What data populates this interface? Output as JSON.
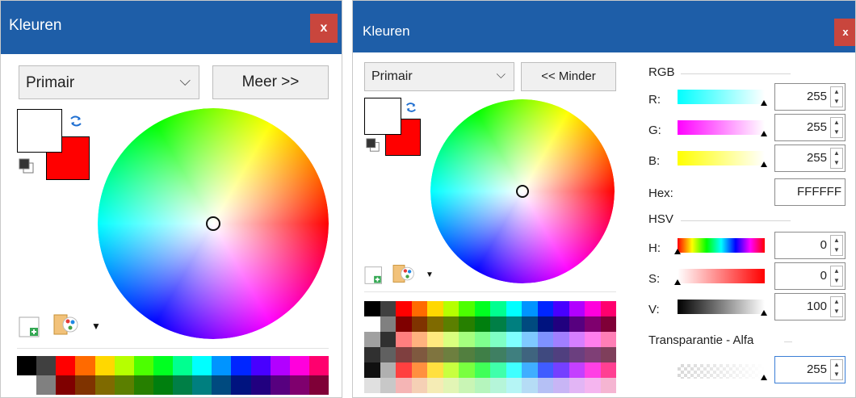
{
  "left": {
    "title": "Kleuren",
    "close_label": "x",
    "mode_select": "Primair",
    "more_button": "Meer >>",
    "colors": {
      "primary": "#ffffff",
      "secondary": "#ff0000"
    }
  },
  "right": {
    "title": "Kleuren",
    "close_label": "x",
    "mode_select": "Primair",
    "less_button": "<< Minder",
    "rgb": {
      "section": "RGB",
      "r_label": "R:",
      "r_value": "255",
      "g_label": "G:",
      "g_value": "255",
      "b_label": "B:",
      "b_value": "255",
      "hex_label": "Hex:",
      "hex_value": "FFFFFF"
    },
    "hsv": {
      "section": "HSV",
      "h_label": "H:",
      "h_value": "0",
      "s_label": "S:",
      "s_value": "0",
      "v_label": "V:",
      "v_value": "100"
    },
    "alpha": {
      "section": "Transparantie - Alfa",
      "value": "255"
    }
  },
  "icons": {
    "chevron": "⌵",
    "swap": "swap-colors-icon",
    "reset": "reset-colors-icon",
    "add_palette": "add-palette-icon",
    "palette_menu": "palette-menu-icon"
  },
  "palette_colors": [
    "#000000",
    "#404040",
    "#ff0000",
    "#ff6a00",
    "#ffd800",
    "#b6ff00",
    "#4cff00",
    "#00ff21",
    "#00ff90",
    "#00ffff",
    "#0094ff",
    "#0026ff",
    "#4800ff",
    "#b200ff",
    "#ff00dc",
    "#ff006e"
  ]
}
